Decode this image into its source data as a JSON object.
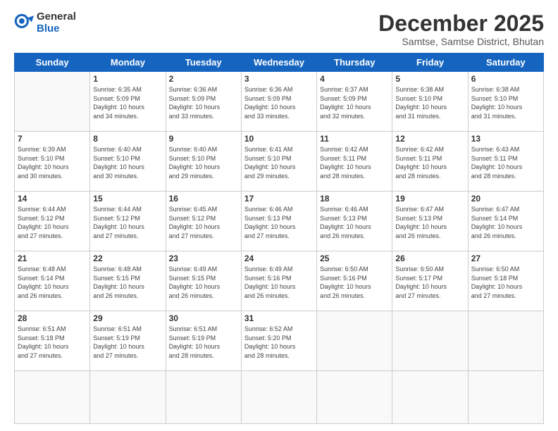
{
  "logo": {
    "general": "General",
    "blue": "Blue"
  },
  "header": {
    "title": "December 2025",
    "subtitle": "Samtse, Samtse District, Bhutan"
  },
  "weekdays": [
    "Sunday",
    "Monday",
    "Tuesday",
    "Wednesday",
    "Thursday",
    "Friday",
    "Saturday"
  ],
  "days": [
    {
      "date": "",
      "info": ""
    },
    {
      "date": "1",
      "info": "Sunrise: 6:35 AM\nSunset: 5:09 PM\nDaylight: 10 hours\nand 34 minutes."
    },
    {
      "date": "2",
      "info": "Sunrise: 6:36 AM\nSunset: 5:09 PM\nDaylight: 10 hours\nand 33 minutes."
    },
    {
      "date": "3",
      "info": "Sunrise: 6:36 AM\nSunset: 5:09 PM\nDaylight: 10 hours\nand 33 minutes."
    },
    {
      "date": "4",
      "info": "Sunrise: 6:37 AM\nSunset: 5:09 PM\nDaylight: 10 hours\nand 32 minutes."
    },
    {
      "date": "5",
      "info": "Sunrise: 6:38 AM\nSunset: 5:10 PM\nDaylight: 10 hours\nand 31 minutes."
    },
    {
      "date": "6",
      "info": "Sunrise: 6:38 AM\nSunset: 5:10 PM\nDaylight: 10 hours\nand 31 minutes."
    },
    {
      "date": "7",
      "info": "Sunrise: 6:39 AM\nSunset: 5:10 PM\nDaylight: 10 hours\nand 30 minutes."
    },
    {
      "date": "8",
      "info": "Sunrise: 6:40 AM\nSunset: 5:10 PM\nDaylight: 10 hours\nand 30 minutes."
    },
    {
      "date": "9",
      "info": "Sunrise: 6:40 AM\nSunset: 5:10 PM\nDaylight: 10 hours\nand 29 minutes."
    },
    {
      "date": "10",
      "info": "Sunrise: 6:41 AM\nSunset: 5:10 PM\nDaylight: 10 hours\nand 29 minutes."
    },
    {
      "date": "11",
      "info": "Sunrise: 6:42 AM\nSunset: 5:11 PM\nDaylight: 10 hours\nand 28 minutes."
    },
    {
      "date": "12",
      "info": "Sunrise: 6:42 AM\nSunset: 5:11 PM\nDaylight: 10 hours\nand 28 minutes."
    },
    {
      "date": "13",
      "info": "Sunrise: 6:43 AM\nSunset: 5:11 PM\nDaylight: 10 hours\nand 28 minutes."
    },
    {
      "date": "14",
      "info": "Sunrise: 6:44 AM\nSunset: 5:12 PM\nDaylight: 10 hours\nand 27 minutes."
    },
    {
      "date": "15",
      "info": "Sunrise: 6:44 AM\nSunset: 5:12 PM\nDaylight: 10 hours\nand 27 minutes."
    },
    {
      "date": "16",
      "info": "Sunrise: 6:45 AM\nSunset: 5:12 PM\nDaylight: 10 hours\nand 27 minutes."
    },
    {
      "date": "17",
      "info": "Sunrise: 6:46 AM\nSunset: 5:13 PM\nDaylight: 10 hours\nand 27 minutes."
    },
    {
      "date": "18",
      "info": "Sunrise: 6:46 AM\nSunset: 5:13 PM\nDaylight: 10 hours\nand 26 minutes."
    },
    {
      "date": "19",
      "info": "Sunrise: 6:47 AM\nSunset: 5:13 PM\nDaylight: 10 hours\nand 26 minutes."
    },
    {
      "date": "20",
      "info": "Sunrise: 6:47 AM\nSunset: 5:14 PM\nDaylight: 10 hours\nand 26 minutes."
    },
    {
      "date": "21",
      "info": "Sunrise: 6:48 AM\nSunset: 5:14 PM\nDaylight: 10 hours\nand 26 minutes."
    },
    {
      "date": "22",
      "info": "Sunrise: 6:48 AM\nSunset: 5:15 PM\nDaylight: 10 hours\nand 26 minutes."
    },
    {
      "date": "23",
      "info": "Sunrise: 6:49 AM\nSunset: 5:15 PM\nDaylight: 10 hours\nand 26 minutes."
    },
    {
      "date": "24",
      "info": "Sunrise: 6:49 AM\nSunset: 5:16 PM\nDaylight: 10 hours\nand 26 minutes."
    },
    {
      "date": "25",
      "info": "Sunrise: 6:50 AM\nSunset: 5:16 PM\nDaylight: 10 hours\nand 26 minutes."
    },
    {
      "date": "26",
      "info": "Sunrise: 6:50 AM\nSunset: 5:17 PM\nDaylight: 10 hours\nand 27 minutes."
    },
    {
      "date": "27",
      "info": "Sunrise: 6:50 AM\nSunset: 5:18 PM\nDaylight: 10 hours\nand 27 minutes."
    },
    {
      "date": "28",
      "info": "Sunrise: 6:51 AM\nSunset: 5:18 PM\nDaylight: 10 hours\nand 27 minutes."
    },
    {
      "date": "29",
      "info": "Sunrise: 6:51 AM\nSunset: 5:19 PM\nDaylight: 10 hours\nand 27 minutes."
    },
    {
      "date": "30",
      "info": "Sunrise: 6:51 AM\nSunset: 5:19 PM\nDaylight: 10 hours\nand 28 minutes."
    },
    {
      "date": "31",
      "info": "Sunrise: 6:52 AM\nSunset: 5:20 PM\nDaylight: 10 hours\nand 28 minutes."
    },
    {
      "date": "",
      "info": ""
    },
    {
      "date": "",
      "info": ""
    },
    {
      "date": "",
      "info": ""
    },
    {
      "date": "",
      "info": ""
    },
    {
      "date": "",
      "info": ""
    },
    {
      "date": "",
      "info": ""
    }
  ]
}
